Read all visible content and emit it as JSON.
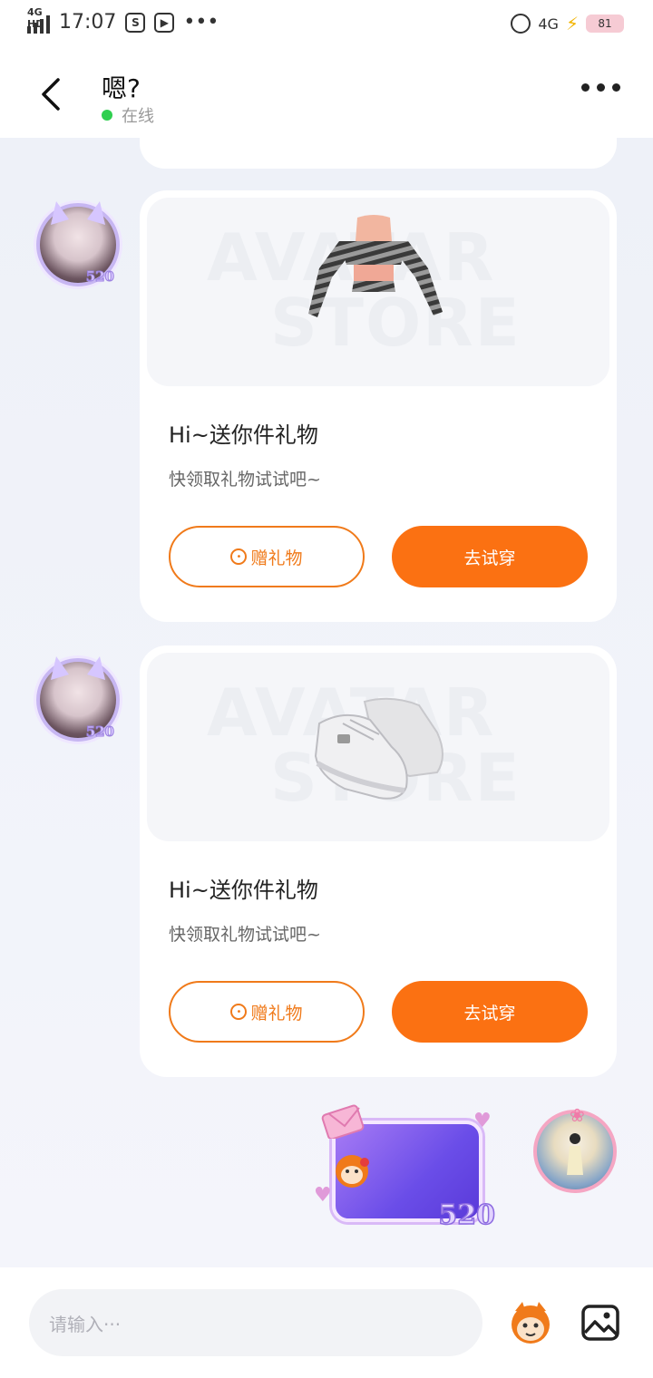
{
  "status_bar": {
    "network_tag": "4G HD",
    "time": "17:07",
    "dots": "•••",
    "network_right": "4G",
    "battery": "81"
  },
  "header": {
    "title": "嗯?",
    "status": "在线"
  },
  "messages": [
    {
      "type": "gift",
      "watermark_top": "AVATAR",
      "watermark_bottom": "STORE",
      "title": "Hi~送你件礼物",
      "subtitle": "快领取礼物试试吧~",
      "gift_button": "赠礼物",
      "try_button": "去试穿",
      "avatar_badge": "520"
    },
    {
      "type": "gift",
      "watermark_top": "AVATAR",
      "watermark_bottom": "STORE",
      "title": "Hi~送你件礼物",
      "subtitle": "快领取礼物试试吧~",
      "gift_button": "赠礼物",
      "try_button": "去试穿",
      "avatar_badge": "520"
    }
  ],
  "sent_sticker": {
    "label": "520"
  },
  "input": {
    "placeholder": "请输入···"
  },
  "colors": {
    "accent": "#fb7112",
    "online": "#2fcf4f",
    "background": "#f3f5fa"
  },
  "icons": [
    "back-arrow-icon",
    "more-icon",
    "emoji-icon",
    "image-icon"
  ]
}
